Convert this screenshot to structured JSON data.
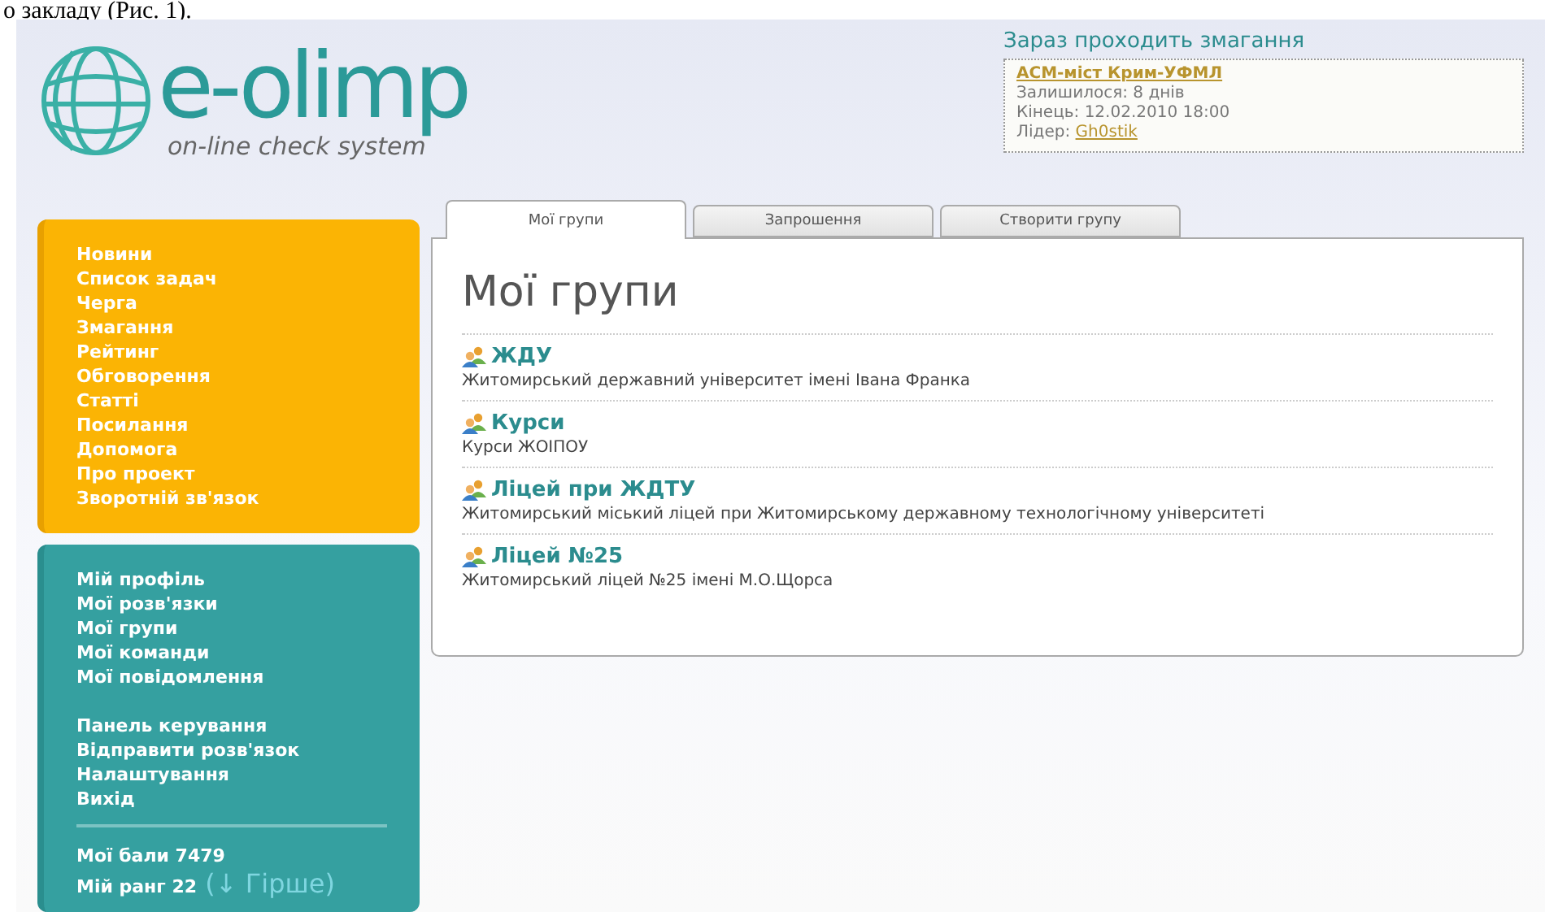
{
  "document_text": "о закладу (Рис. 1).",
  "logo": {
    "name": "e-olimp",
    "tagline": "on-line check system"
  },
  "contest": {
    "heading": "Зараз проходить змагання",
    "name": "ACM-міст Крим-УФМЛ",
    "remaining": "Залишилося: 8 днів",
    "end": "Кінець: 12.02.2010 18:00",
    "leader_label": "Лідер:",
    "leader": "Gh0stik"
  },
  "main_menu": [
    "Новини",
    "Список задач",
    "Черга",
    "Змагання",
    "Рейтинг",
    "Обговорення",
    "Статті",
    "Посилання",
    "Допомога",
    "Про проект",
    "Зворотній зв'язок"
  ],
  "user_menu": {
    "groups": [
      [
        "Мій профіль",
        "Мої розв'язки",
        "Мої групи",
        "Мої команди",
        "Мої повідомлення"
      ],
      [
        "Панель керування",
        "Відправити розв'язок",
        "Налаштування",
        "Вихід"
      ]
    ],
    "points": "Мої бали 7479",
    "rank": "Мій ранг 22",
    "rank_change": "(↓ Гірше)"
  },
  "tabs": [
    {
      "label": "Мої групи",
      "selected": true
    },
    {
      "label": "Запрошення",
      "selected": false
    },
    {
      "label": "Створити групу",
      "selected": false
    }
  ],
  "page_title": "Мої групи",
  "groups": [
    {
      "name": "ЖДУ",
      "description": "Житомирський державний університет імені Івана Франка"
    },
    {
      "name": "Курси",
      "description": "Курси ЖОІПОУ"
    },
    {
      "name": "Ліцей при ЖДТУ",
      "description": "Житомирський міський ліцей при Житомирському державному технологічному університеті"
    },
    {
      "name": "Ліцей №25",
      "description": "Житомирський ліцей №25 імені М.О.Щорса"
    }
  ]
}
